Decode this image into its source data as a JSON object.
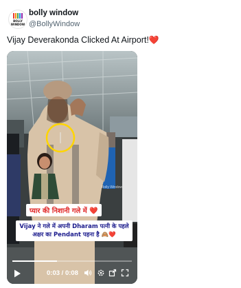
{
  "account": {
    "name": "bolly window",
    "handle": "@BollyWindow",
    "avatar_text": "BOLLY WINDOW"
  },
  "tweet": {
    "text": "Vijay Deverakonda Clicked At Airport!",
    "emoji": "❤️"
  },
  "video": {
    "caption_line1": "प्यार की निशानी गले में ❤️",
    "caption_line2": "Vijay ने गले में अपनी Dharam पत्नी के पहले अक्षर का Pendant पहना है 🙈❤️",
    "watermark": "Bolly Window",
    "time_current": "0:03",
    "time_total": "0:08",
    "time_separator": "/",
    "progress": 0.375
  },
  "colors": {
    "accent_red": "#e0245e",
    "caption_red": "#e02424",
    "caption_blue": "#1a1a8c",
    "highlight_circle": "#ffd500"
  },
  "icons": {
    "play": "play-icon",
    "volume": "volume-icon",
    "settings": "settings-icon",
    "fullscreen": "fullscreen-icon"
  }
}
